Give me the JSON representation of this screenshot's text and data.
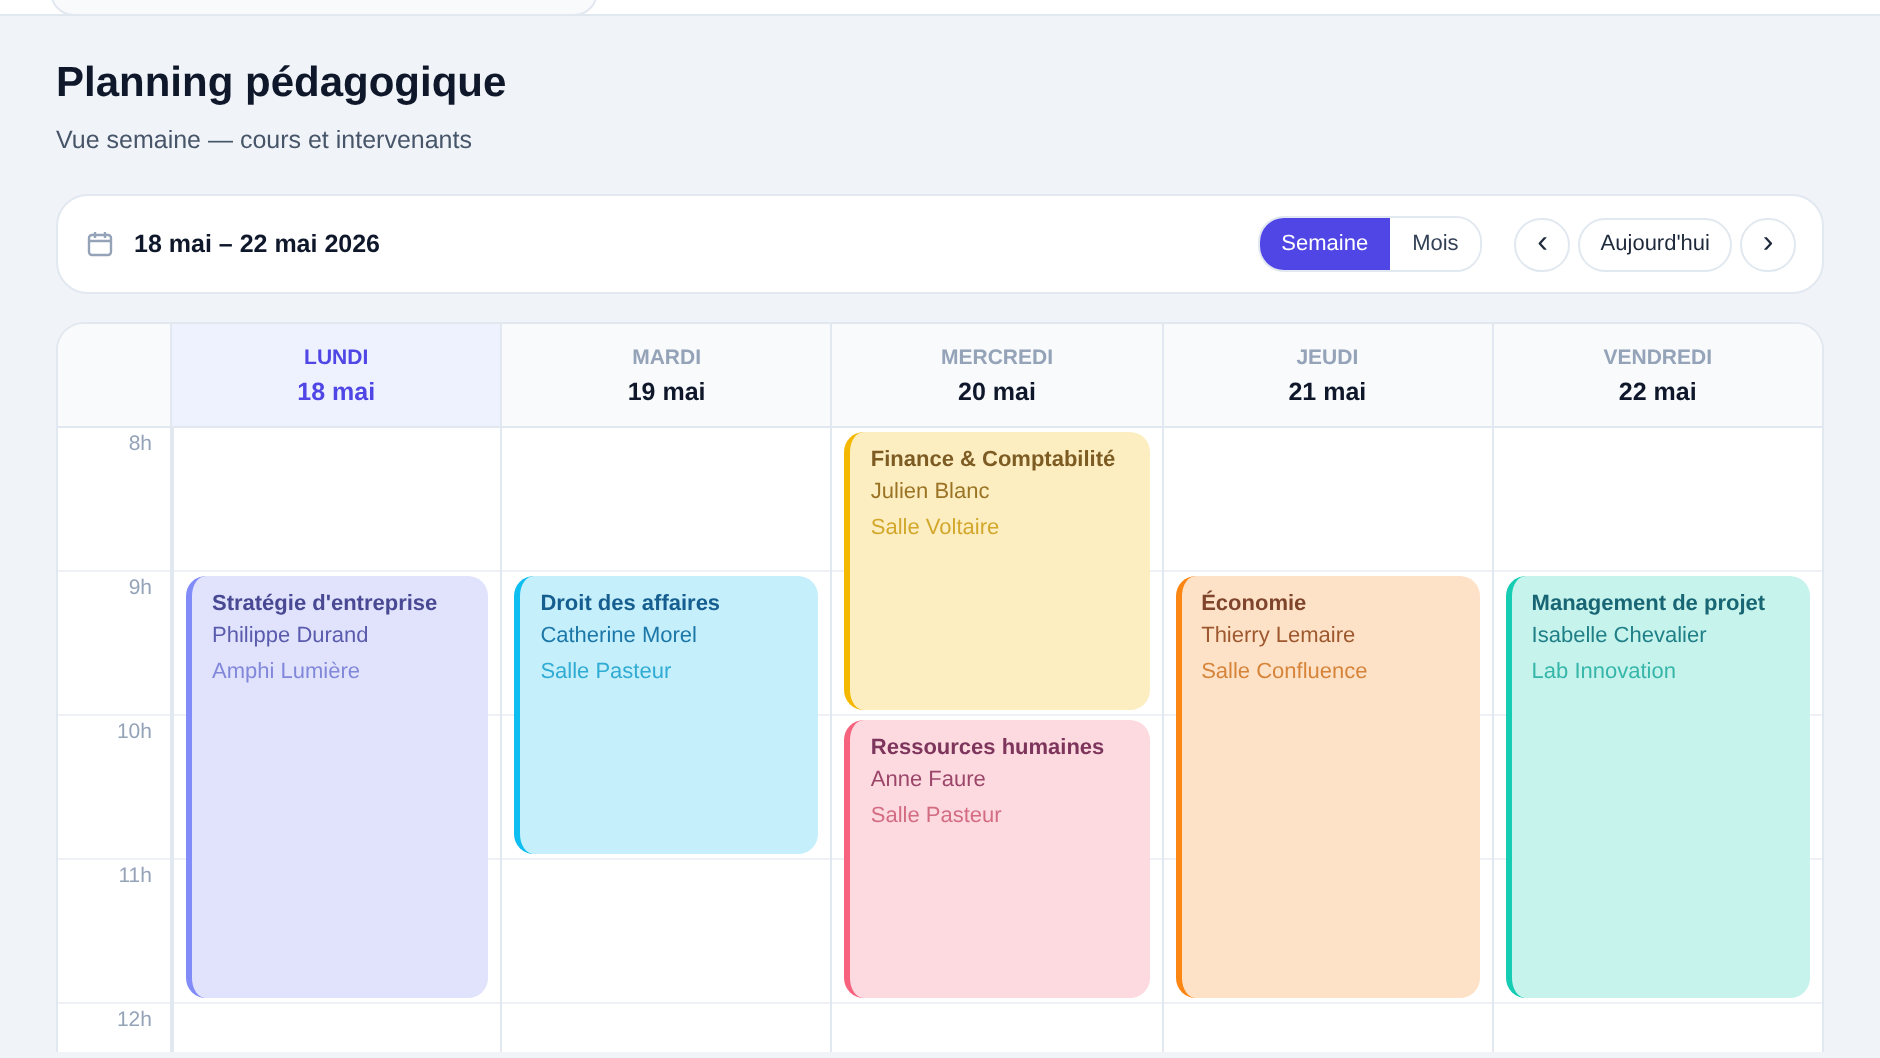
{
  "page": {
    "title": "Planning pédagogique",
    "subtitle": "Vue semaine — cours et intervenants"
  },
  "toolbar": {
    "date_range": "18 mai – 22 mai 2026",
    "views": [
      {
        "label": "Semaine",
        "selected": true
      },
      {
        "label": "Mois",
        "selected": false
      }
    ],
    "prev": "‹",
    "today": "Aujourd'hui",
    "next": "›"
  },
  "calendar": {
    "hours": [
      "8h",
      "9h",
      "10h",
      "11h",
      "12h"
    ],
    "days": [
      {
        "weekday": "LUNDI",
        "date": "18 mai",
        "selected": true,
        "blocks": [
          {
            "kind": "free"
          },
          {
            "kind": "triple",
            "title": "Stratégie d'entreprise",
            "teacher": "Philippe Durand",
            "room": "Amphi Lumière",
            "color": "#818cf8"
          },
          {
            "kind": "free"
          }
        ]
      },
      {
        "weekday": "MARDI",
        "date": "19 mai",
        "selected": false,
        "blocks": [
          {
            "kind": "free"
          },
          {
            "kind": "double",
            "title": "Droit des affaires",
            "teacher": "Catherine Morel",
            "room": "Salle Pasteur",
            "color": "#0ebef0"
          },
          {
            "kind": "free"
          },
          {
            "kind": "free"
          }
        ]
      },
      {
        "weekday": "MERCREDI",
        "date": "20 mai",
        "selected": false,
        "blocks": [
          {
            "kind": "double",
            "title": "Finance & Comptabilité",
            "teacher": "Julien Blanc",
            "room": "Salle Voltaire",
            "color": "#f5b800"
          },
          {
            "kind": "double",
            "title": "Ressources humaines",
            "teacher": "Anne Faure",
            "room": "Salle Pasteur",
            "color": "#f7637e"
          },
          {
            "kind": "free"
          }
        ]
      },
      {
        "weekday": "JEUDI",
        "date": "21 mai",
        "selected": false,
        "blocks": [
          {
            "kind": "free"
          },
          {
            "kind": "triple",
            "title": "Économie",
            "teacher": "Thierry Lemaire",
            "room": "Salle Confluence",
            "color": "#fb8614"
          },
          {
            "kind": "free"
          }
        ]
      },
      {
        "weekday": "VENDREDI",
        "date": "22 mai",
        "selected": false,
        "blocks": [
          {
            "kind": "free"
          },
          {
            "kind": "triple",
            "title": "Management de projet",
            "teacher": "Isabelle Chevalier",
            "room": "Lab Innovation",
            "color": "#16cdb4"
          },
          {
            "kind": "free"
          }
        ]
      }
    ]
  }
}
